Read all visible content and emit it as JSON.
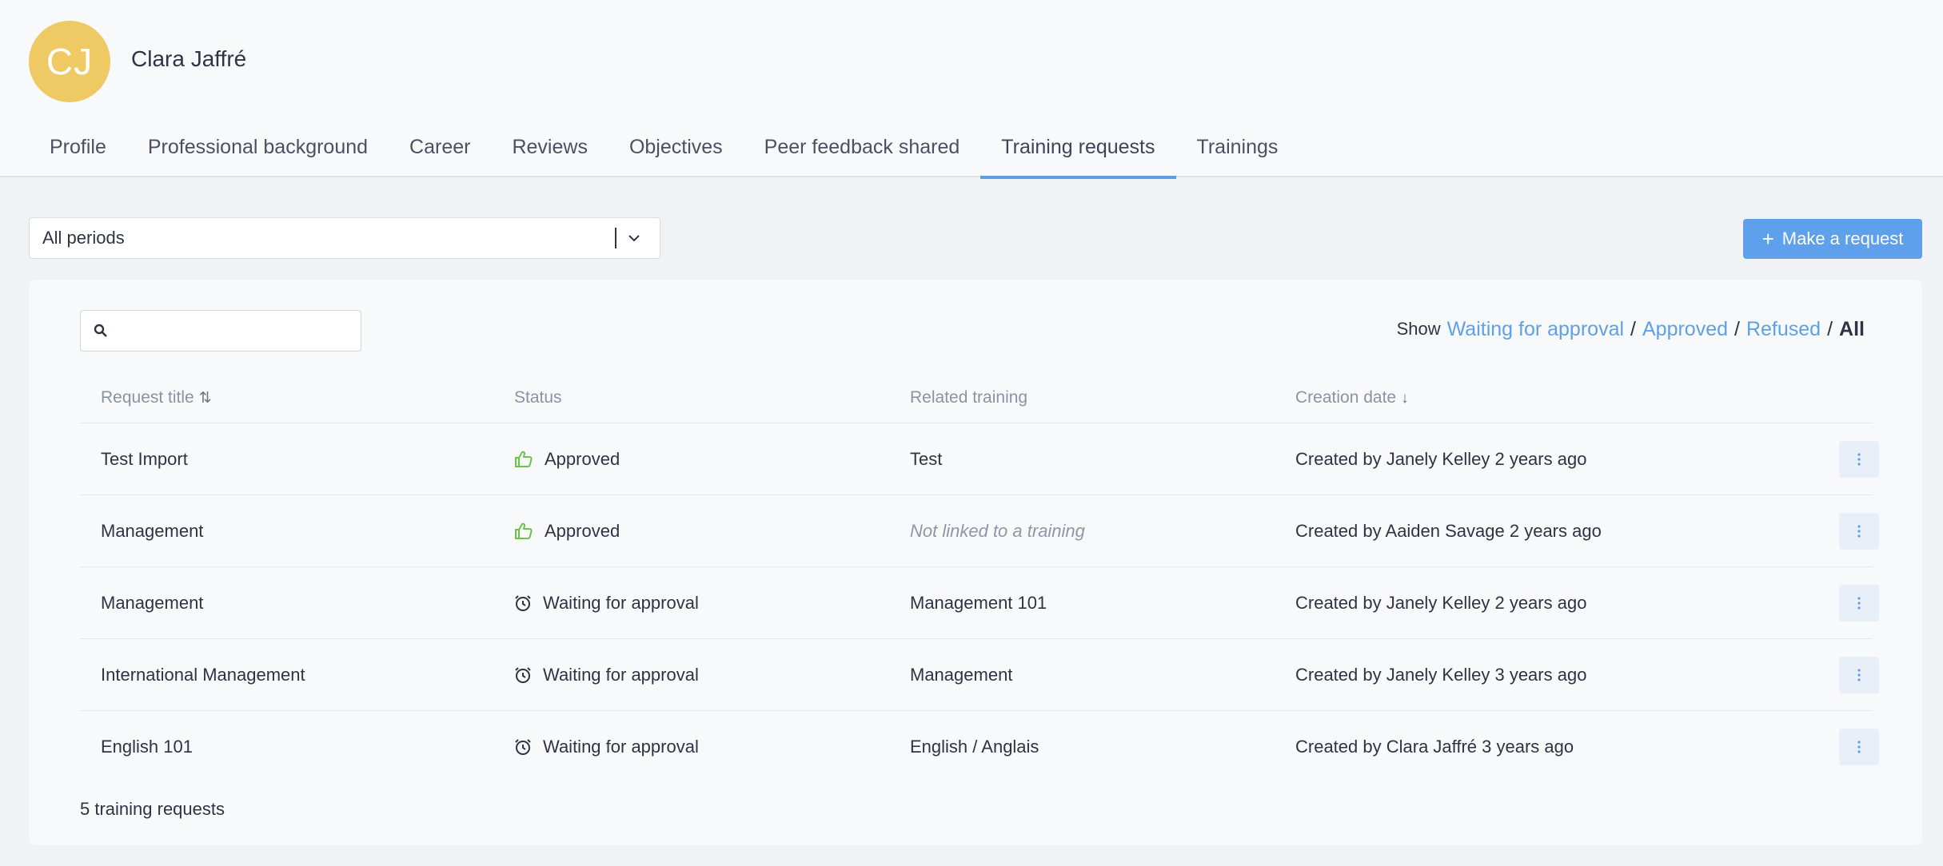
{
  "user": {
    "initials": "CJ",
    "name": "Clara Jaffré"
  },
  "tabs": [
    {
      "label": "Profile"
    },
    {
      "label": "Professional background"
    },
    {
      "label": "Career"
    },
    {
      "label": "Reviews"
    },
    {
      "label": "Objectives"
    },
    {
      "label": "Peer feedback shared"
    },
    {
      "label": "Training requests",
      "active": true
    },
    {
      "label": "Trainings"
    }
  ],
  "period_select": {
    "value": "All periods"
  },
  "make_request": {
    "label": "Make a request"
  },
  "search": {
    "placeholder": "",
    "value": ""
  },
  "filter": {
    "label": "Show",
    "options": [
      "Waiting for approval",
      "Approved",
      "Refused",
      "All"
    ],
    "selected": "All"
  },
  "table": {
    "columns": [
      "Request title",
      "Status",
      "Related training",
      "Creation date"
    ],
    "rows": [
      {
        "title": "Test Import",
        "status": "Approved",
        "status_icon": "thumbs-up-icon",
        "training": "Test",
        "training_muted": false,
        "created": "Created by Janely Kelley 2 years ago"
      },
      {
        "title": "Management",
        "status": "Approved",
        "status_icon": "thumbs-up-icon",
        "training": "Not linked to a training",
        "training_muted": true,
        "created": "Created by Aaiden Savage 2 years ago"
      },
      {
        "title": "Management",
        "status": "Waiting for approval",
        "status_icon": "alarm-clock-icon",
        "training": "Management 101",
        "training_muted": false,
        "created": "Created by Janely Kelley 2 years ago"
      },
      {
        "title": "International Management",
        "status": "Waiting for approval",
        "status_icon": "alarm-clock-icon",
        "training": "Management",
        "training_muted": false,
        "created": "Created by Janely Kelley 3 years ago"
      },
      {
        "title": "English 101",
        "status": "Waiting for approval",
        "status_icon": "alarm-clock-icon",
        "training": "English / Anglais",
        "training_muted": false,
        "created": "Created by Clara Jaffré 3 years ago"
      }
    ]
  },
  "footer": {
    "count_label": "5 training requests"
  },
  "colors": {
    "accent": "#5ea0ec",
    "avatar": "#efc964",
    "approved": "#6cc24a"
  }
}
